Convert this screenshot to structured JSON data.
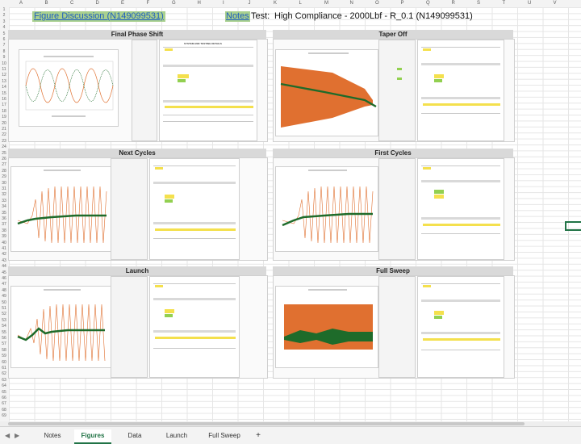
{
  "sheet_header": {
    "figure_link": "Figure Discussion (N149099531)",
    "notes_link": "Notes",
    "test_label": "Test:",
    "test_value": "High Compliance - 2000Lbf - R_0.1 (N149099531)"
  },
  "column_letters": [
    "A",
    "B",
    "C",
    "D",
    "E",
    "F",
    "G",
    "H",
    "I",
    "J",
    "K",
    "L",
    "M",
    "N",
    "O",
    "P",
    "Q",
    "R",
    "S",
    "T",
    "U",
    "V"
  ],
  "row_numbers": [
    "1",
    "2",
    "3",
    "4",
    "5",
    "6",
    "7",
    "8",
    "9",
    "10",
    "11",
    "12",
    "13",
    "14",
    "15",
    "16",
    "17",
    "18",
    "19",
    "20",
    "21",
    "22",
    "23",
    "24",
    "25",
    "26",
    "27",
    "28",
    "29",
    "30",
    "31",
    "32",
    "33",
    "34",
    "35",
    "36",
    "37",
    "38",
    "39",
    "40",
    "41",
    "42",
    "43",
    "44",
    "45",
    "46",
    "47",
    "48",
    "49",
    "50",
    "51",
    "52",
    "53",
    "54",
    "55",
    "56",
    "57",
    "58",
    "59",
    "60",
    "61",
    "62",
    "63",
    "64",
    "65",
    "66",
    "67",
    "68",
    "69"
  ],
  "tiles": [
    {
      "title": "Final Phase Shift"
    },
    {
      "title": "Taper Off"
    },
    {
      "title": "Next Cycles"
    },
    {
      "title": "First Cycles"
    },
    {
      "title": "Launch"
    },
    {
      "title": "Full Sweep"
    }
  ],
  "report_heading": "SYSTEM AND TESTING DETAILS",
  "sheet_tabs": [
    {
      "label": "Notes",
      "active": false
    },
    {
      "label": "Figures",
      "active": true
    },
    {
      "label": "Data",
      "active": false
    },
    {
      "label": "Launch",
      "active": false
    },
    {
      "label": "Full Sweep",
      "active": false
    }
  ],
  "add_sheet_symbol": "+",
  "colors": {
    "orange": "#e07030",
    "green": "#1e6b2a",
    "excel_green": "#217346"
  }
}
